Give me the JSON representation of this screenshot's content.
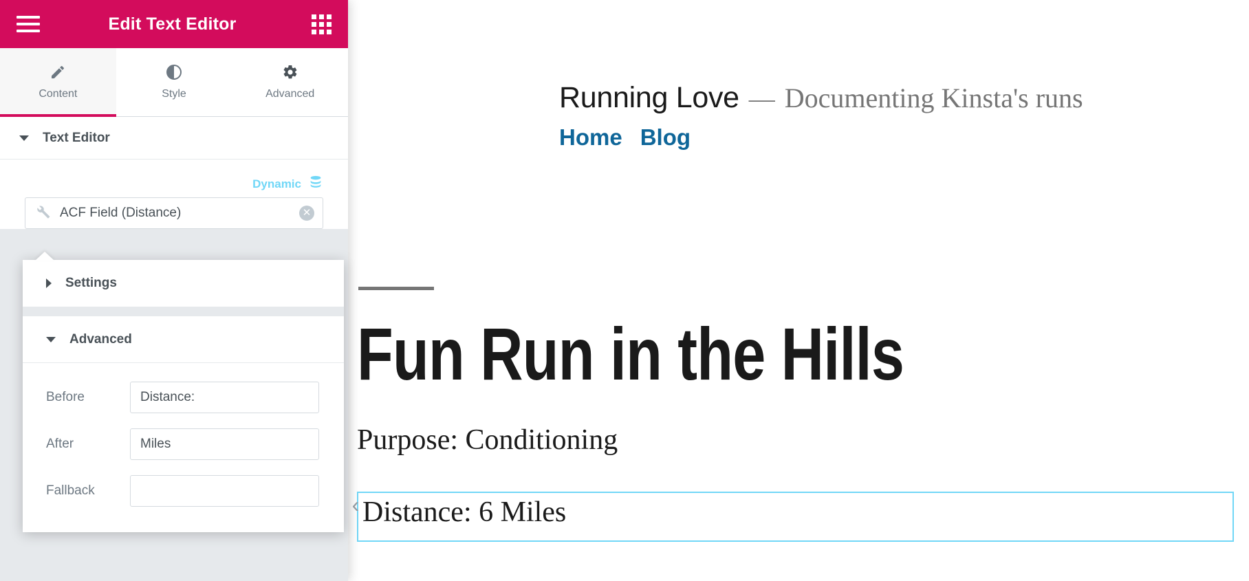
{
  "panel": {
    "header": {
      "menu_icon": "hamburger-icon",
      "title": "Edit Text Editor",
      "apps_icon": "grid-icon"
    },
    "tabs": [
      {
        "label": "Content",
        "icon": "pencil-icon",
        "active": true
      },
      {
        "label": "Style",
        "icon": "contrast-icon",
        "active": false
      },
      {
        "label": "Advanced",
        "icon": "gear-icon",
        "active": false
      }
    ],
    "content_section": {
      "title": "Text Editor",
      "expanded": true
    },
    "dynamic": {
      "label": "Dynamic",
      "icon": "database-icon"
    },
    "tag_field": {
      "icon": "wrench-icon",
      "value": "ACF Field (Distance)",
      "clear_icon": "close-circle-icon"
    },
    "popup": {
      "settings": {
        "title": "Settings",
        "expanded": false
      },
      "advanced": {
        "title": "Advanced",
        "expanded": true,
        "fields": [
          {
            "label": "Before",
            "value": "Distance:",
            "placeholder": ""
          },
          {
            "label": "After",
            "value": "Miles",
            "placeholder": ""
          },
          {
            "label": "Fallback",
            "value": "",
            "placeholder": ""
          }
        ]
      }
    }
  },
  "preview": {
    "site_title": "Running Love",
    "site_separator": "—",
    "site_tagline": "Documenting Kinsta's runs",
    "nav": [
      {
        "label": "Home"
      },
      {
        "label": "Blog"
      }
    ],
    "post": {
      "title": "Fun Run in the Hills",
      "purpose_line": "Purpose: Conditioning",
      "distance_line": "Distance: 6 Miles"
    },
    "widget_handle_icon": "chevron-left-icon"
  },
  "colors": {
    "brand_pink": "#d30c5c",
    "accent_cyan": "#71d7f7",
    "nav_blue": "#0f6699",
    "panel_bg": "#e6e9ec"
  }
}
